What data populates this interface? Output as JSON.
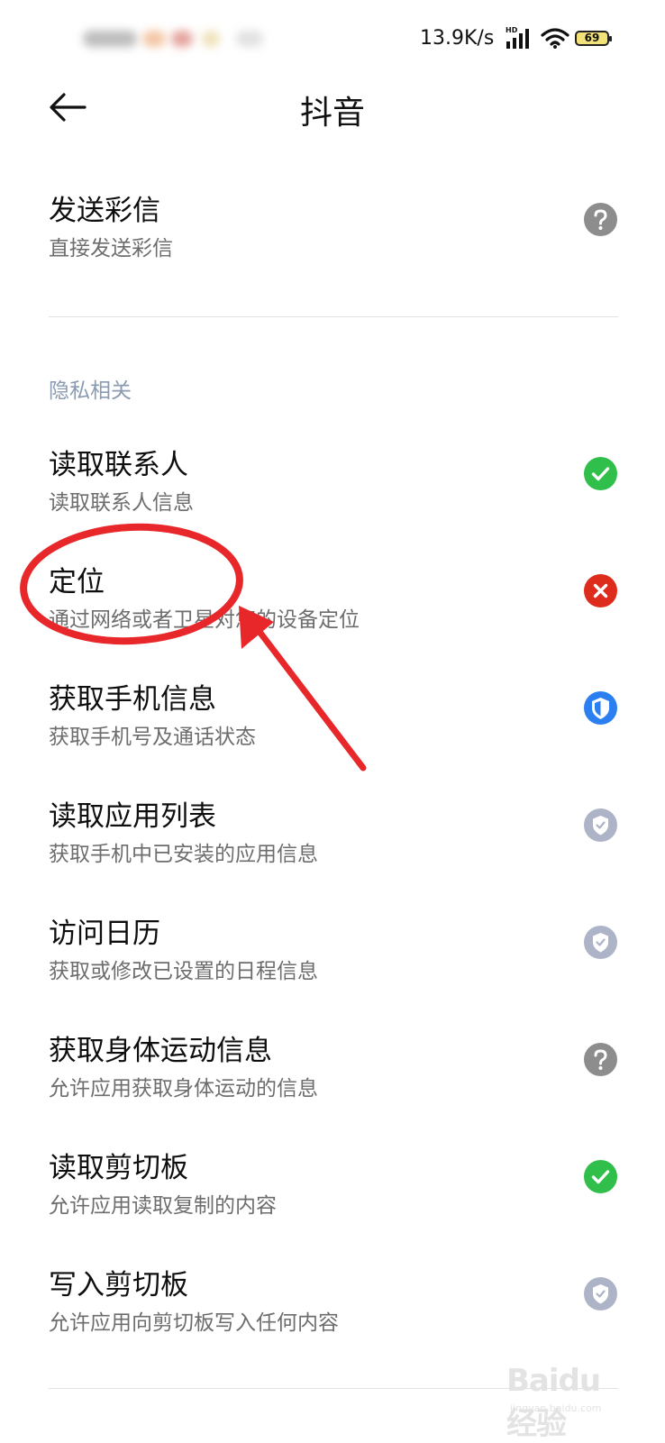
{
  "status_bar": {
    "net_speed": "13.9K/s",
    "hd_label": "HD",
    "battery_level": "69"
  },
  "header": {
    "title": "抖音"
  },
  "mms": {
    "title": "发送彩信",
    "desc": "直接发送彩信",
    "status": "ask"
  },
  "section_title": "隐私相关",
  "permissions": [
    {
      "title": "读取联系人",
      "desc": "读取联系人信息",
      "status": "allowed"
    },
    {
      "title": "定位",
      "desc": "通过网络或者卫星对您的设备定位",
      "status": "denied"
    },
    {
      "title": "获取手机信息",
      "desc": "获取手机号及通话状态",
      "status": "while-using"
    },
    {
      "title": "读取应用列表",
      "desc": "获取手机中已安装的应用信息",
      "status": "default-allowed"
    },
    {
      "title": "访问日历",
      "desc": "获取或修改已设置的日程信息",
      "status": "default-allowed"
    },
    {
      "title": "获取身体运动信息",
      "desc": "允许应用获取身体运动的信息",
      "status": "ask"
    },
    {
      "title": "读取剪切板",
      "desc": "允许应用读取复制的内容",
      "status": "allowed"
    },
    {
      "title": "写入剪切板",
      "desc": "允许应用向剪切板写入任何内容",
      "status": "default-allowed"
    }
  ],
  "watermark": {
    "brand": "Baidu经验",
    "site": "jingyan.baidu.com"
  },
  "colors": {
    "allowed": "#2fbf4a",
    "denied": "#dd2c1c",
    "while-using": "#2b7ff0",
    "ask": "#8d8d8d",
    "default-allowed": "#aeb4c7",
    "annotation": "#e8272a"
  },
  "icons": {
    "allowed": "check-circle-icon",
    "denied": "cross-circle-icon",
    "while-using": "half-shield-icon",
    "ask": "question-circle-icon",
    "default-allowed": "shield-check-icon"
  }
}
